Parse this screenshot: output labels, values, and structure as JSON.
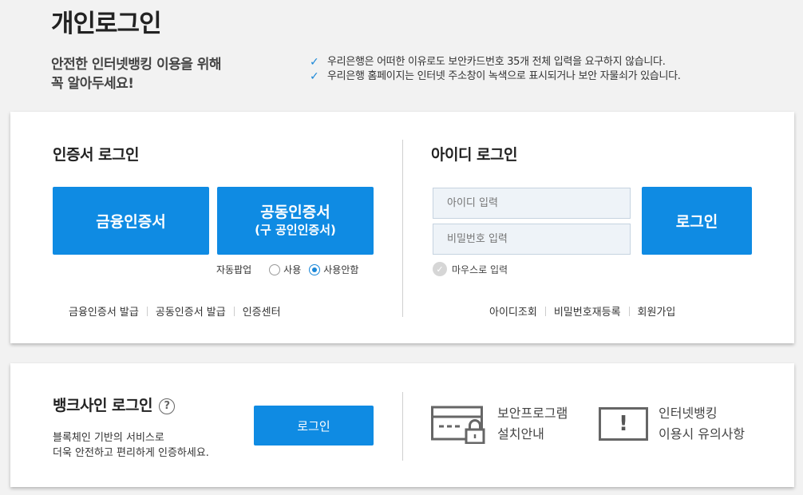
{
  "page": {
    "title": "개인로그인",
    "intro_line1": "안전한 인터넷뱅킹 이용을 위해",
    "intro_line2": "꼭 알아두세요!",
    "notices": [
      "우리은행은 어떠한 이유로도 보안카드번호 35개 전체 입력을 요구하지 않습니다.",
      "우리은행 홈페이지는 인터넷 주소창이 녹색으로 표시되거나 보안 자물쇠가 있습니다."
    ]
  },
  "cert": {
    "title": "인증서 로그인",
    "financial_label": "금융인증서",
    "joint_label": "공동인증서",
    "joint_sub": "(구 공인인증서)",
    "popup_label": "자동팝업",
    "popup_options": [
      "사용",
      "사용안함"
    ],
    "popup_selected": "사용안함",
    "links": [
      "금융인증서 발급",
      "공동인증서 발급",
      "인증센터"
    ]
  },
  "id_login": {
    "title": "아이디 로그인",
    "id_placeholder": "아이디 입력",
    "pw_placeholder": "비밀번호 입력",
    "mouse_label": "마우스로 입력",
    "login_label": "로그인",
    "links": [
      "아이디조회",
      "비밀번호재등록",
      "회원가입"
    ]
  },
  "banksign": {
    "title": "뱅크사인 로그인",
    "help_icon": "?",
    "desc_line1": "블록체인 기반의 서비스로",
    "desc_line2": "더욱 안전하고 편리하게 인증하세요.",
    "login_label": "로그인"
  },
  "info": {
    "security_line1": "보안프로그램",
    "security_line2": "설치안내",
    "caution_line1": "인터넷뱅킹",
    "caution_line2": "이용시 유의사항",
    "caution_icon_text": "!"
  },
  "colors": {
    "accent": "#0f8be3",
    "check": "#1a87d8",
    "background": "#f2f2f2"
  }
}
